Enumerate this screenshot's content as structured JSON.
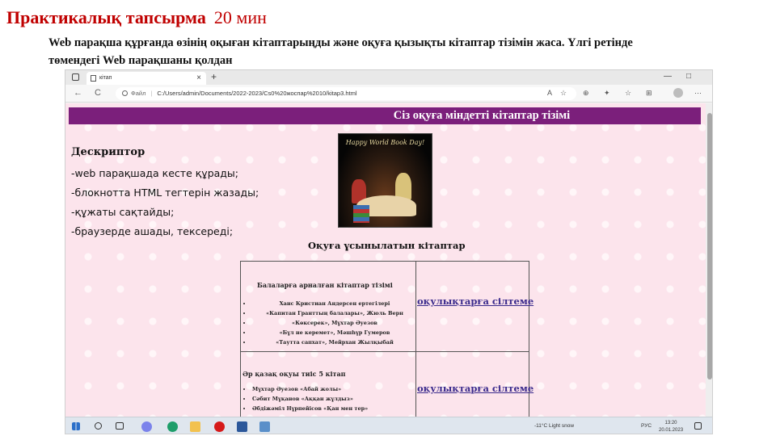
{
  "slide": {
    "title": "Практикалық тапсырма",
    "time": "20 мин",
    "description": "Web парақша құрғанда өзінің оқыған кітаптарыңды және оқуға қызықты кітаптар тізімін жаса. Үлгі ретінде төмендегі Web парақшаны қолдан"
  },
  "browser": {
    "tab_title": "кітап",
    "tab_close": "×",
    "new_tab": "+",
    "window_controls": [
      "—",
      "□"
    ],
    "url_prefix": "Файл",
    "url": "C:/Users/admin/Documents/2022-2023/Cs0%20жоспар%2010/kitap3.html",
    "nav": [
      "←",
      "C"
    ],
    "tools": [
      "A",
      "☆",
      "⊕",
      "✦",
      "☆",
      "⊞",
      "⋯"
    ]
  },
  "webpage": {
    "banner": "Сіз оқуға міндетті кітаптар тізімі",
    "image_caption": "Happy World Book Day!",
    "descriptor": {
      "title": "Дескриптор",
      "items": [
        "-web парақшада кесте құрады;",
        "-блокнотта HTML тегтерін жазады;",
        "-құжаты сақтайды;",
        "-браузерде ашады, тексереді;"
      ]
    },
    "recommended_title": "Оқуға ұсынылатын кітаптар",
    "table": [
      {
        "list_title": "Балаларға арналған кітаптар тізімі",
        "books": [
          "Ханс Кристиан Андерсен ертегілері",
          "«Капитан Гранттың балалары», Жюль Верн",
          "«Көксерек», Мұхтар Әуезов",
          "«Бұл не керемет», Мәшһүр Гумеров",
          "«Таутта сапхат», Мейрхан Жылқыбай"
        ],
        "link": "оқулықтарға сілтеме"
      },
      {
        "list_title": "Әр қазақ оқуы тиіс 5 кітап",
        "books": [
          "Мұхтар Әуезов «Абай жолы»",
          "Сәбит Мұқанов «Аққан жұлдыз»",
          "Әбдіжәміл Нұрпейісов «Қан мен тер»"
        ],
        "link": "оқулықтарға сілтеме"
      }
    ]
  },
  "taskbar": {
    "weather": "-11°C Light snow",
    "language": "РУС",
    "time": "13:20",
    "date": "20.01.2023",
    "apps": [
      "windows",
      "search",
      "task-view",
      "teams",
      "edge",
      "explorer",
      "opera",
      "word",
      "app"
    ]
  },
  "colors": {
    "title_red": "#c00000",
    "banner_purple": "#7b1f7b",
    "page_pink": "#fce4ec",
    "link_blue": "#3a2a8c"
  }
}
